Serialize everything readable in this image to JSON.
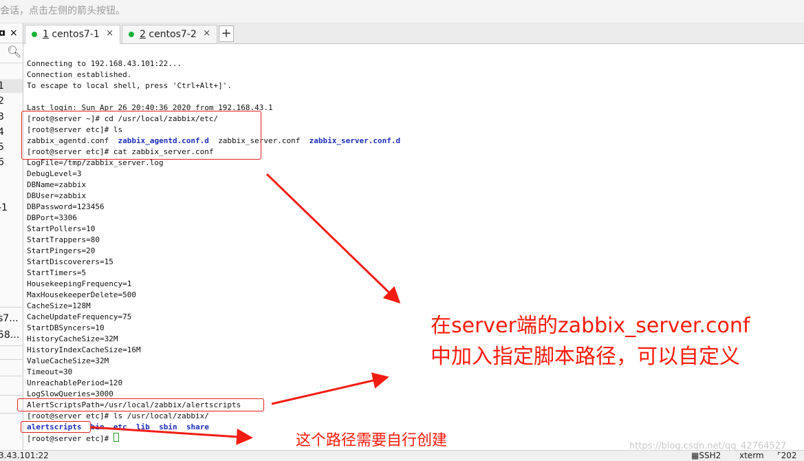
{
  "hint": "会话，点击左侧的箭头按钮。",
  "left_panel": {
    "pin": "ɑ",
    "close": "×",
    "items": [
      "1",
      "2",
      "3",
      "4",
      "5",
      "6",
      "-1"
    ],
    "lower_items": [
      "s7...",
      "58..."
    ]
  },
  "tabs": [
    {
      "num": "1",
      "label": "centos7-1",
      "close": "×"
    },
    {
      "num": "2",
      "label": "centos7-2",
      "close": "×"
    }
  ],
  "new_tab": "+",
  "terminal": {
    "lines": [
      "Connecting to 192.168.43.101:22...",
      "Connection established.",
      "To escape to local shell, press 'Ctrl+Alt+]'.",
      "",
      "Last login: Sun Apr 26 20:40:36 2020 from 192.168.43.1",
      "[root@server ~]# cd /usr/local/zabbix/etc/",
      "[root@server etc]# ls"
    ],
    "ls1": [
      "zabbix_agentd.conf",
      "zabbix_agentd.conf.d",
      "zabbix_server.conf",
      "zabbix_server.conf.d"
    ],
    "lines2": [
      "[root@server etc]# cat zabbix_server.conf",
      "LogFile=/tmp/zabbix_server.log",
      "DebugLevel=3",
      "DBName=zabbix",
      "DBUser=zabbix",
      "DBPassword=123456",
      "DBPort=3306",
      "StartPollers=10",
      "StartTrappers=80",
      "StartPingers=20",
      "StartDiscoverers=15",
      "StartTimers=5",
      "HousekeepingFrequency=1",
      "MaxHousekeeperDelete=500",
      "CacheSize=128M",
      "CacheUpdateFrequency=75",
      "StartDBSyncers=10",
      "HistoryCacheSize=32M",
      "HistoryIndexCacheSize=16M",
      "ValueCacheSize=32M",
      "Timeout=30",
      "UnreachablePeriod=120",
      "LogSlowQueries=3000",
      "AlertScriptsPath=/usr/local/zabbix/alertscripts",
      "[root@server etc]# ls /usr/local/zabbix/"
    ],
    "ls2": [
      "alertscripts",
      "bin",
      "etc",
      "lib",
      "sbin",
      "share"
    ],
    "prompt": "[root@server etc]# "
  },
  "annotations": {
    "main_line1": "在server端的zabbix_server.conf",
    "main_line2": "中加入指定脚本路径，可以自定义",
    "bottom": "这个路径需要自行创建",
    "color": "#ff1a0a"
  },
  "status": {
    "host": "3.43.101:22",
    "protocol": "SSH2",
    "term": "xterm",
    "year": "202"
  },
  "watermark": "https://blog.csdn.net/qq_42764527"
}
